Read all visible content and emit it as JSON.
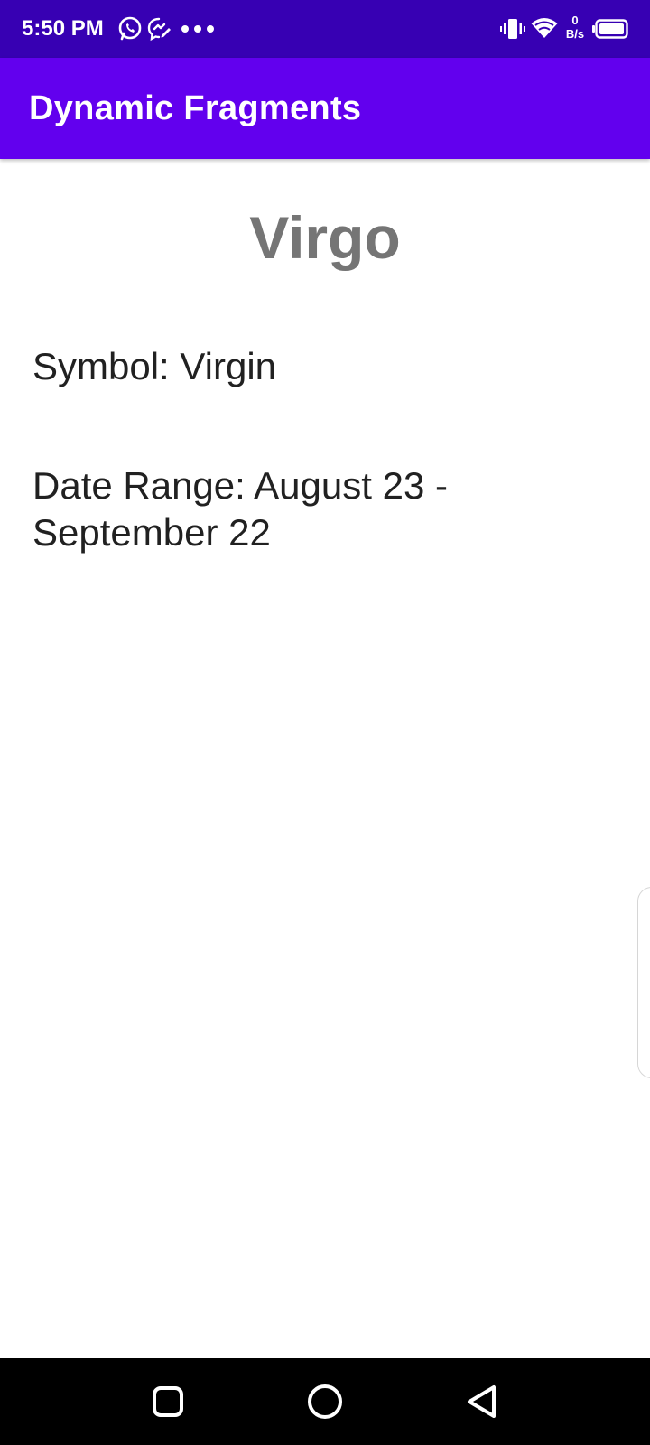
{
  "status_bar": {
    "time": "5:50 PM",
    "net_speed_value": "0",
    "net_speed_unit": "B/s",
    "icons": [
      "whatsapp-icon",
      "messenger-icon",
      "more-dots-icon",
      "vibrate-icon",
      "wifi-icon",
      "battery-icon"
    ]
  },
  "app_bar": {
    "title": "Dynamic Fragments"
  },
  "content": {
    "sign_name": "Virgo",
    "symbol_text": "Symbol: Virgin",
    "date_range_text": "Date Range: August 23 - September 22"
  },
  "nav_bar": {
    "icons": [
      "recents-square-icon",
      "home-circle-icon",
      "back-triangle-icon"
    ]
  },
  "colors": {
    "status_bar": "#3700b3",
    "app_bar": "#6200ee",
    "title_gray": "#757575",
    "body_text": "#212121",
    "nav_bar": "#000000"
  }
}
